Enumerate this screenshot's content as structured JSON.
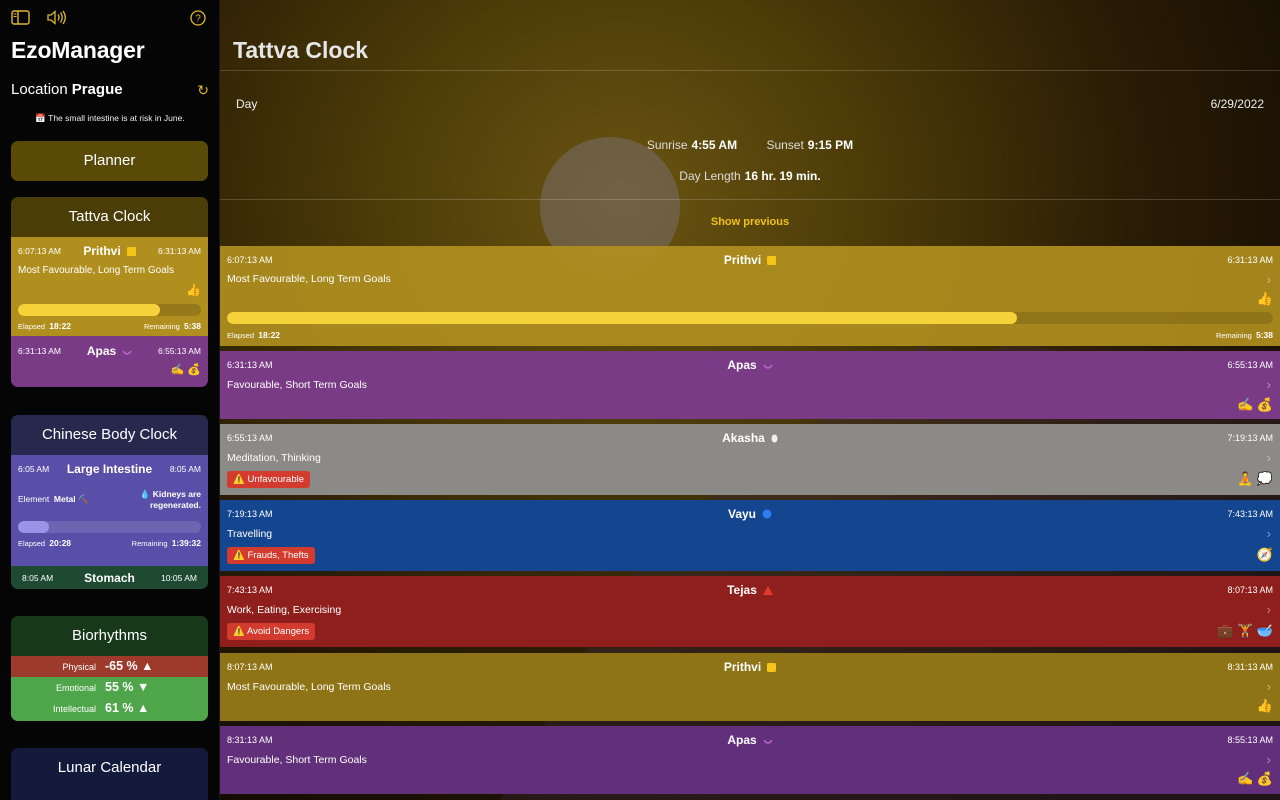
{
  "colors": {
    "accent": "#f2c21b",
    "prithvi": "#b08f1f",
    "apas": "#7a3b86",
    "akasha": "#8c8a86",
    "vayu": "#14468f",
    "tejas": "#8e1f1c",
    "warning": "#d23b2e"
  },
  "sidebar": {
    "icons": [
      "sidebar-toggle-icon",
      "speaker-icon",
      "help-icon"
    ],
    "app_title": "EzoManager",
    "location_label": "Location",
    "location_value": "Prague",
    "refresh_icon": "↻",
    "notice_icon": "📅",
    "notice_text": "The small intestine is at risk in June.",
    "planner_label": "Planner",
    "tattva_card": {
      "title": "Tattva Clock",
      "current": {
        "start": "6:07:13 AM",
        "name": "Prithvi",
        "end": "6:31:13 AM",
        "description": "Most Favourable, Long Term Goals",
        "icon": "👍",
        "progress": 0.775,
        "elapsed_label": "Elapsed",
        "elapsed_value": "18:22",
        "remaining_label": "Remaining",
        "remaining_value": "5:38"
      },
      "next": {
        "start": "6:31:13 AM",
        "name": "Apas",
        "end": "6:55:13 AM",
        "icons": "✍️ 💰"
      }
    },
    "chinese_card": {
      "title": "Chinese Body Clock",
      "current": {
        "start": "6:05 AM",
        "organ": "Large Intestine",
        "end": "8:05 AM",
        "element_label": "Element",
        "element_value": "Metal",
        "element_icon": "⛏️",
        "note_icon": "💧",
        "note": "Kidneys are regenerated.",
        "progress": 0.17,
        "elapsed_label": "Elapsed",
        "elapsed_value": "20:28",
        "remaining_label": "Remaining",
        "remaining_value": "1:39:32"
      },
      "next": {
        "start": "8:05 AM",
        "organ": "Stomach",
        "end": "10:05 AM"
      }
    },
    "biorhythms": {
      "title": "Biorhythms",
      "rows": [
        {
          "label": "Physical",
          "value": "-65 %",
          "trend": "▲",
          "color": "#9d3a2c"
        },
        {
          "label": "Emotional",
          "value": "55 %",
          "trend": "▼",
          "color": "#4fa64a"
        },
        {
          "label": "Intellectual",
          "value": "61 %",
          "trend": "▲",
          "color": "#4fa64a"
        }
      ]
    },
    "lunar": {
      "title": "Lunar Calendar"
    }
  },
  "main": {
    "title": "Tattva Clock",
    "day_label": "Day",
    "date": "6/29/2022",
    "sunrise_label": "Sunrise",
    "sunrise_value": "4:55 AM",
    "sunset_label": "Sunset",
    "sunset_value": "9:15 PM",
    "day_length_label": "Day Length",
    "day_length_value": "16 hr. 19 min.",
    "show_previous": "Show previous",
    "current": {
      "start": "6:07:13 AM",
      "name": "Prithvi",
      "end": "6:31:13 AM",
      "description": "Most Favourable, Long Term Goals",
      "icons": "👍",
      "progress": 0.755,
      "elapsed_label": "Elapsed",
      "elapsed_value": "18:22",
      "remaining_label": "Remaining",
      "remaining_value": "5:38"
    },
    "rows": [
      {
        "start": "6:31:13 AM",
        "name": "Apas",
        "symbol": "moon",
        "end": "6:55:13 AM",
        "description": "Favourable, Short Term Goals",
        "icons": "✍️ 💰",
        "badge": "",
        "color": "#7a3b86"
      },
      {
        "start": "6:55:13 AM",
        "name": "Akasha",
        "symbol": "egg",
        "end": "7:19:13 AM",
        "description": "Meditation, Thinking",
        "icons": "🧘 💭",
        "badge": "Unfavourable",
        "color": "#8c8a86"
      },
      {
        "start": "7:19:13 AM",
        "name": "Vayu",
        "symbol": "circle",
        "end": "7:43:13 AM",
        "description": "Travelling",
        "icons": "🧭",
        "badge": "Frauds, Thefts",
        "color": "#14468f"
      },
      {
        "start": "7:43:13 AM",
        "name": "Tejas",
        "symbol": "triangle",
        "end": "8:07:13 AM",
        "description": "Work, Eating, Exercising",
        "icons": "💼 🏋️ 🥣",
        "badge": "Avoid Dangers",
        "color": "#8e1f1c"
      },
      {
        "start": "8:07:13 AM",
        "name": "Prithvi",
        "symbol": "square",
        "end": "8:31:13 AM",
        "description": "Most Favourable, Long Term Goals",
        "icons": "👍",
        "badge": "",
        "color": "#8f7417"
      },
      {
        "start": "8:31:13 AM",
        "name": "Apas",
        "symbol": "moon",
        "end": "8:55:13 AM",
        "description": "Favourable, Short Term Goals",
        "icons": "✍️ 💰",
        "badge": "",
        "color": "#62307a"
      }
    ]
  }
}
